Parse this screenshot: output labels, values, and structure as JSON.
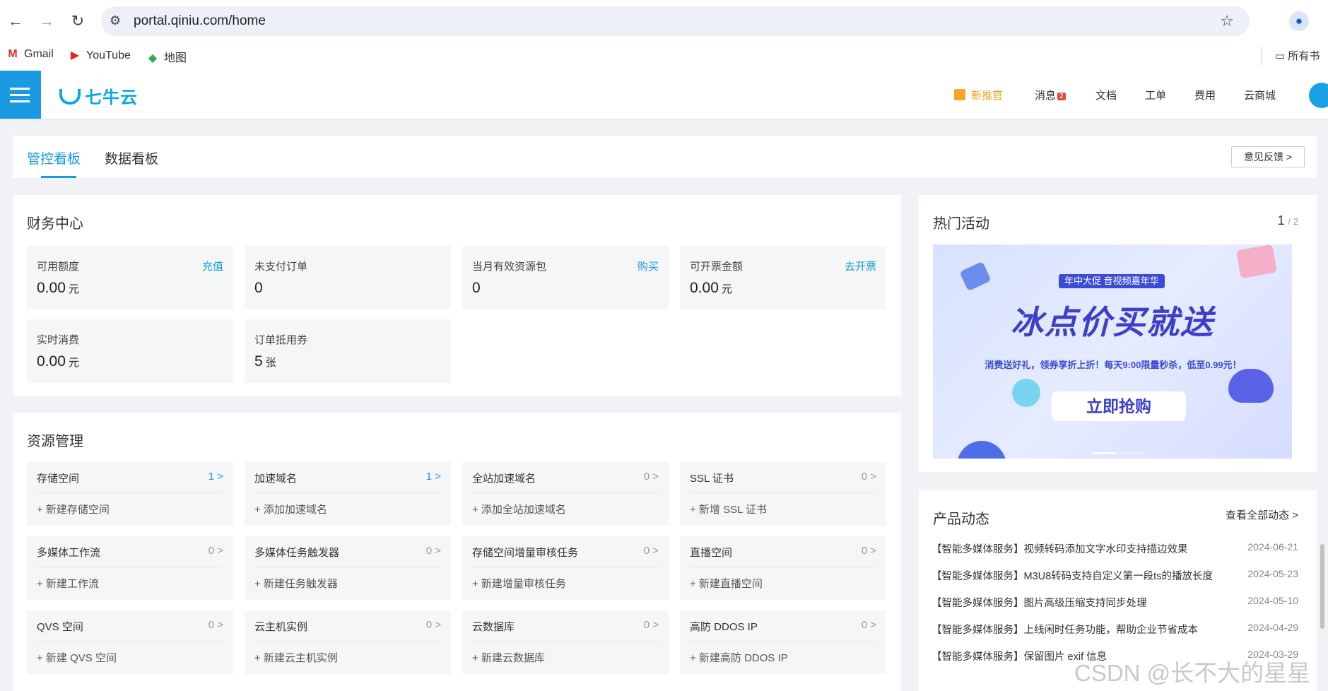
{
  "browser": {
    "url": "portal.qiniu.com/home",
    "bookmarks": [
      {
        "label": "Gmail",
        "icon": "gmail-icon"
      },
      {
        "label": "YouTube",
        "icon": "youtube-icon"
      },
      {
        "label": "地图",
        "icon": "maps-icon"
      }
    ],
    "all_bookmarks": "所有书"
  },
  "app": {
    "logo_text": "七牛云",
    "nav": {
      "recommend": "新推官",
      "messages": "消息",
      "message_count": "2",
      "docs": "文档",
      "tickets": "工单",
      "billing": "费用",
      "store": "云商城"
    }
  },
  "tabs": {
    "items": [
      "管控看板",
      "数据看板"
    ],
    "feedback": "意见反馈 >"
  },
  "finance": {
    "title": "财务中心",
    "tiles": [
      {
        "label": "可用额度",
        "action": "充值",
        "value": "0.00",
        "unit": "元"
      },
      {
        "label": "未支付订单",
        "action": "",
        "value": "0",
        "unit": ""
      },
      {
        "label": "当月有效资源包",
        "action": "购买",
        "value": "0",
        "unit": ""
      },
      {
        "label": "可开票金额",
        "action": "去开票",
        "value": "0.00",
        "unit": "元"
      },
      {
        "label": "实时消费",
        "action": "",
        "value": "0.00",
        "unit": "元"
      },
      {
        "label": "订单抵用券",
        "action": "",
        "value": "5",
        "unit": "张"
      }
    ]
  },
  "resources": {
    "title": "资源管理",
    "tiles": [
      {
        "label": "存储空间",
        "count": "1 >",
        "add": "+ 新建存储空间"
      },
      {
        "label": "加速域名",
        "count": "1 >",
        "add": "+ 添加加速域名"
      },
      {
        "label": "全站加速域名",
        "count": "0 >",
        "add": "+ 添加全站加速域名"
      },
      {
        "label": "SSL 证书",
        "count": "0 >",
        "add": "+ 新增 SSL 证书"
      },
      {
        "label": "多媒体工作流",
        "count": "0 >",
        "add": "+ 新建工作流"
      },
      {
        "label": "多媒体任务触发器",
        "count": "0 >",
        "add": "+ 新建任务触发器"
      },
      {
        "label": "存储空间增量审核任务",
        "count": "0 >",
        "add": "+ 新建增量审核任务"
      },
      {
        "label": "直播空间",
        "count": "0 >",
        "add": "+ 新建直播空间"
      },
      {
        "label": "QVS 空间",
        "count": "0 >",
        "add": "+ 新建 QVS 空间"
      },
      {
        "label": "云主机实例",
        "count": "0 >",
        "add": "+ 新建云主机实例"
      },
      {
        "label": "云数据库",
        "count": "0 >",
        "add": "+ 新建云数据库"
      },
      {
        "label": "高防 DDOS IP",
        "count": "0 >",
        "add": "+ 新建高防 DDOS IP"
      }
    ]
  },
  "hot": {
    "title": "热门活动",
    "page_current": "1",
    "page_total": "/ 2",
    "banner": {
      "tag": "年中大促 音视频嘉年华",
      "headline": "冰点价买就送",
      "subline": "消费送好礼，领券享折上折！每天9:00限量秒杀，低至0.99元！",
      "button": "立即抢购"
    }
  },
  "product": {
    "title": "产品动态",
    "see_all": "查看全部动态 >",
    "items": [
      {
        "text": "【智能多媒体服务】视频转码添加文字水印支持描边效果",
        "date": "2024-06-21"
      },
      {
        "text": "【智能多媒体服务】M3U8转码支持自定义第一段ts的播放长度",
        "date": "2024-05-23"
      },
      {
        "text": "【智能多媒体服务】图片高级压缩支持同步处理",
        "date": "2024-05-10"
      },
      {
        "text": "【智能多媒体服务】上线闲时任务功能，帮助企业节省成本",
        "date": "2024-04-29"
      },
      {
        "text": "【智能多媒体服务】保留图片 exif 信息",
        "date": "2024-03-29"
      }
    ]
  },
  "watermark": "CSDN @长不大的星星"
}
